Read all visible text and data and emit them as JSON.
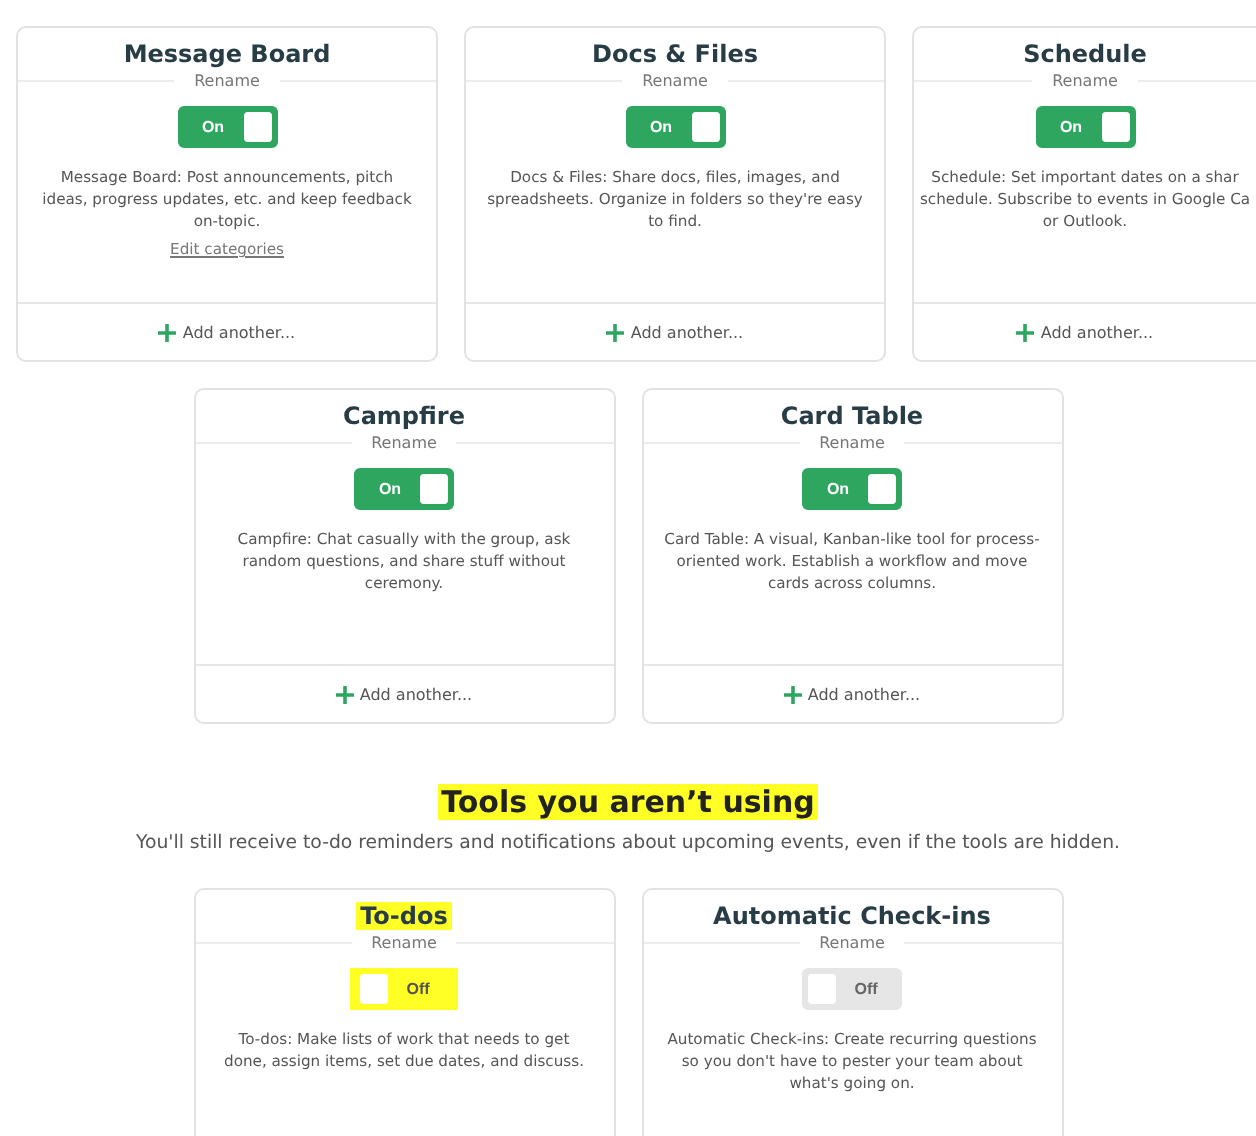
{
  "tool_rows": [
    {
      "cards": [
        {
          "title": "Message Board",
          "title_highlighted": false,
          "rename": "Rename",
          "toggle": {
            "label": "On",
            "on": true
          },
          "description_lines": [
            "Message Board: Post announcements, pitch",
            "ideas, progress updates, etc. and keep feedback",
            "on-topic."
          ],
          "link": "Edit categories",
          "add": "Add another..."
        },
        {
          "title": "Docs & Files",
          "title_highlighted": false,
          "rename": "Rename",
          "toggle": {
            "label": "On",
            "on": true
          },
          "description_lines": [
            "Docs & Files: Share docs, files, images, and",
            "spreadsheets. Organize in folders so they're easy",
            "to find."
          ],
          "add": "Add another..."
        },
        {
          "title": "Schedule",
          "title_highlighted": false,
          "rename": "Rename",
          "toggle": {
            "label": "On",
            "on": true
          },
          "description_lines": [
            "Schedule: Set important dates on a shar",
            "schedule. Subscribe to events in Google Ca",
            "or Outlook."
          ],
          "add": "Add another..."
        }
      ]
    },
    {
      "cards": [
        {
          "title": "Campfire",
          "title_highlighted": false,
          "rename": "Rename",
          "toggle": {
            "label": "On",
            "on": true
          },
          "description_lines": [
            "Campfire: Chat casually with the group, ask",
            "random questions, and share stuff without",
            "ceremony."
          ],
          "add": "Add another..."
        },
        {
          "title": "Card Table",
          "title_highlighted": false,
          "rename": "Rename",
          "toggle": {
            "label": "On",
            "on": true
          },
          "description_lines": [
            "Card Table: A visual, Kanban-like tool for process-",
            "oriented work. Establish a workflow and move",
            "cards across columns."
          ],
          "add": "Add another..."
        }
      ]
    }
  ],
  "unused_section": {
    "heading": "Tools you aren’t using",
    "heading_highlighted": true,
    "subtitle": "You'll still receive to-do reminders and notifications about upcoming events, even if the tools are hidden.",
    "cards": [
      {
        "title": "To-dos",
        "title_highlighted": true,
        "rename": "Rename",
        "toggle": {
          "label": "Off",
          "on": false,
          "highlighted": true
        },
        "description_lines": [
          "To-dos: Make lists of work that needs to get",
          "done, assign items, set due dates, and discuss."
        ]
      },
      {
        "title": "Automatic Check-ins",
        "title_highlighted": false,
        "rename": "Rename",
        "toggle": {
          "label": "Off",
          "on": false
        },
        "description_lines": [
          "Automatic Check-ins: Create recurring questions",
          "so you don't have to pester your team about",
          "what's going on."
        ]
      }
    ]
  }
}
